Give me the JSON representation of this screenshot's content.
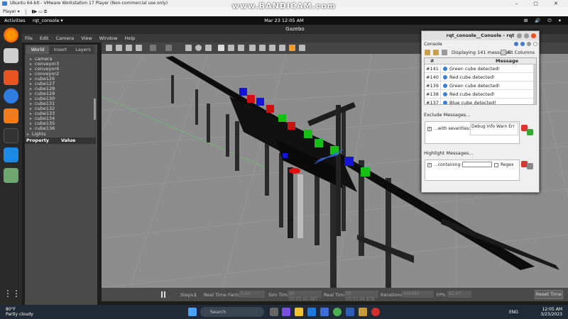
{
  "recorder": {
    "watermark": "www.BANDICAM.com"
  },
  "vmware": {
    "title": "Ubuntu 64-bit - VMware Workstation 17 Player (Non-commercial use only)",
    "menu": "Player ▾"
  },
  "ubuntu": {
    "activities": "Activities",
    "app": "rqt_console ▾",
    "clock": "Mar 23  12:05 AM"
  },
  "gazebo": {
    "title": "Gazebo",
    "menu": [
      "File",
      "Edit",
      "Camera",
      "View",
      "Window",
      "Help"
    ],
    "tabs": [
      "World",
      "Insert",
      "Layers"
    ],
    "tree": [
      "camera",
      "conveyor3",
      "conveyor4",
      "conveyor2",
      "cube126",
      "cube127",
      "cube128",
      "cube129",
      "cube130",
      "cube131",
      "cube132",
      "cube133",
      "cube134",
      "cube135",
      "cube136",
      "Lights"
    ],
    "props": {
      "property": "Property",
      "value": "Value"
    },
    "bottom": {
      "steps_label": "Steps:",
      "steps_value": "1",
      "rtf_label": "Real Time Factor:",
      "rtf_value": "0.43",
      "sim_label": "Sim Time:",
      "sim_value": "00 00:01:45.497",
      "real_label": "Real Time:",
      "real_value": "00 00:03:44.879",
      "iter_label": "Iterations:",
      "iter_value": "105497",
      "fps_label": "FPS:",
      "fps_value": "62.07",
      "reset": "Reset Time"
    }
  },
  "rqt": {
    "title": "rqt_console__Console - rqt",
    "sub": "Console",
    "count": "Displaying 141 messages",
    "fit": "Fit Columns",
    "col_id": "#",
    "col_msg": "Message",
    "rows": [
      {
        "id": "#141",
        "msg": "Green cube detected!"
      },
      {
        "id": "#140",
        "msg": "Red cube detected!"
      },
      {
        "id": "#139",
        "msg": "Green cube detected!"
      },
      {
        "id": "#138",
        "msg": "Red cube detected!"
      },
      {
        "id": "#137",
        "msg": "Blue cube detected!"
      }
    ],
    "exclude_title": "Exclude Messages...",
    "exclude_label": "...with severities:",
    "severities": [
      "Debug",
      "Info",
      "Warn",
      "Err"
    ],
    "highlight_title": "Highlight Messages...",
    "highlight_label": "...containing:",
    "regex": "Regex"
  },
  "taskbar": {
    "temp": "80°F",
    "weather": "Partly cloudy",
    "search": "Search",
    "lang": "ENG",
    "time": "12:05 AM",
    "date": "3/23/2023"
  }
}
